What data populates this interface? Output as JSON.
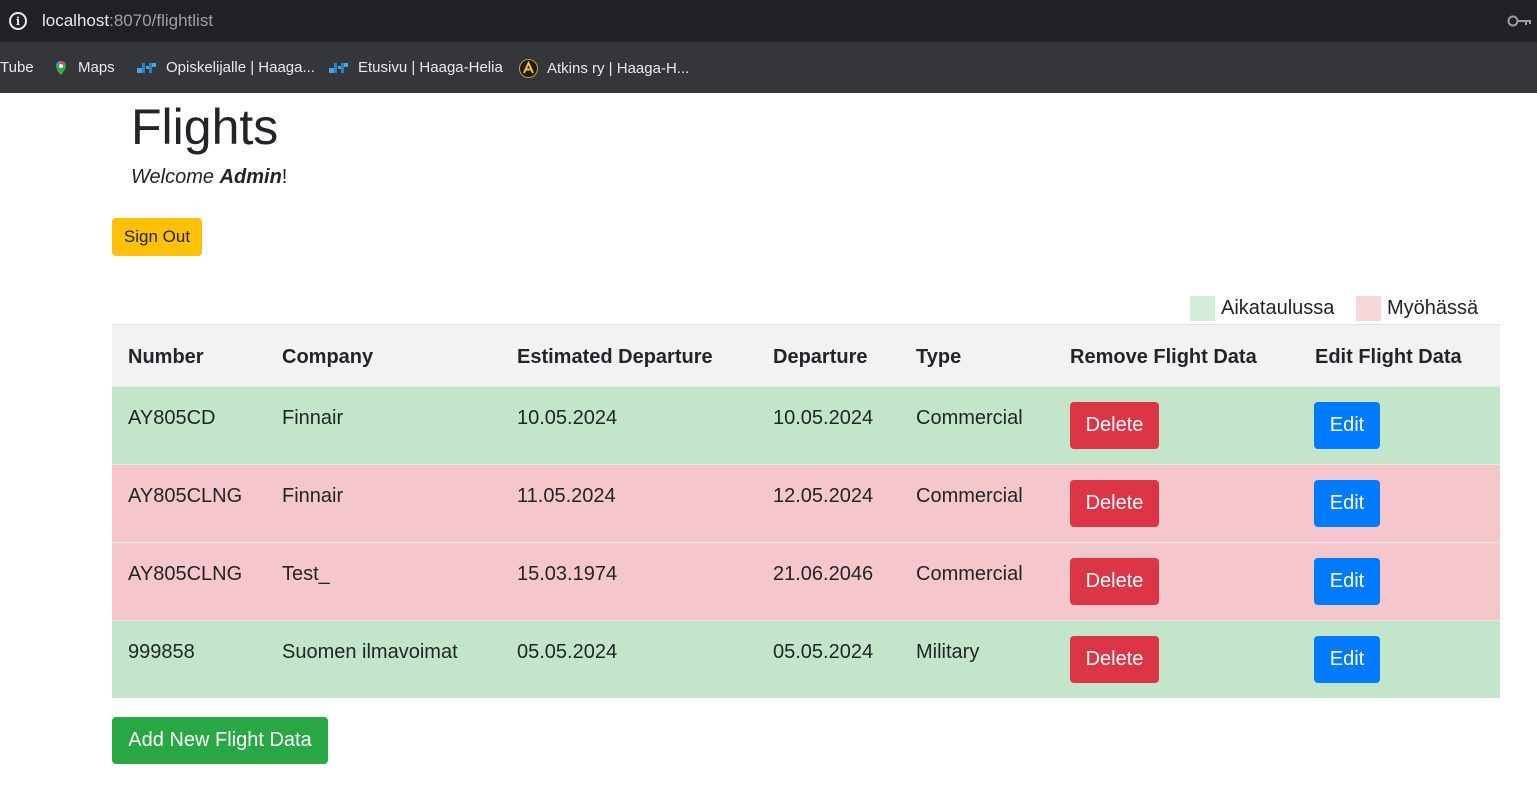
{
  "browser": {
    "url_host": "localhost",
    "url_path": ":8070/flightlist",
    "bookmarks": [
      {
        "label": "Tube",
        "icon": "none"
      },
      {
        "label": "Maps",
        "icon": "maps-pin-icon"
      },
      {
        "label": "Opiskelijalle | Haaga...",
        "icon": "haaga-helia-icon"
      },
      {
        "label": "Etusivu | Haaga-Helia",
        "icon": "haaga-helia-icon"
      },
      {
        "label": "Atkins ry | Haaga-H...",
        "icon": "atkins-icon"
      }
    ]
  },
  "page": {
    "title": "Flights",
    "welcome_prefix": "Welcome",
    "username": "Admin",
    "welcome_suffix": "!",
    "sign_out_label": "Sign Out",
    "add_label": "Add New Flight Data"
  },
  "legend": [
    {
      "label": "Aikataulussa",
      "color": "#d4edda"
    },
    {
      "label": "Myöhässä",
      "color": "#f8d7da"
    }
  ],
  "table": {
    "headers": [
      "Number",
      "Company",
      "Estimated Departure",
      "Departure",
      "Type",
      "Remove Flight Data",
      "Edit Flight Data"
    ],
    "rows": [
      {
        "number": "AY805CD",
        "company": "Finnair",
        "estimated": "10.05.2024",
        "departure": "10.05.2024",
        "type": "Commercial",
        "status": "on-time",
        "color": "#c3e6cb"
      },
      {
        "number": "AY805CLNG",
        "company": "Finnair",
        "estimated": "11.05.2024",
        "departure": "12.05.2024",
        "type": "Commercial",
        "status": "delayed",
        "color": "#f5c6cb"
      },
      {
        "number": "AY805CLNG",
        "company": "Test_",
        "estimated": "15.03.1974",
        "departure": "21.06.2046",
        "type": "Commercial",
        "status": "delayed",
        "color": "#f5c6cb"
      },
      {
        "number": "999858",
        "company": "Suomen ilmavoimat",
        "estimated": "05.05.2024",
        "departure": "05.05.2024",
        "type": "Military",
        "status": "on-time",
        "color": "#c3e6cb"
      }
    ],
    "delete_label": "Delete",
    "edit_label": "Edit"
  },
  "colors": {
    "warning": "#ffc107",
    "danger": "#dc3545",
    "primary": "#007bff",
    "success": "#28a745"
  }
}
